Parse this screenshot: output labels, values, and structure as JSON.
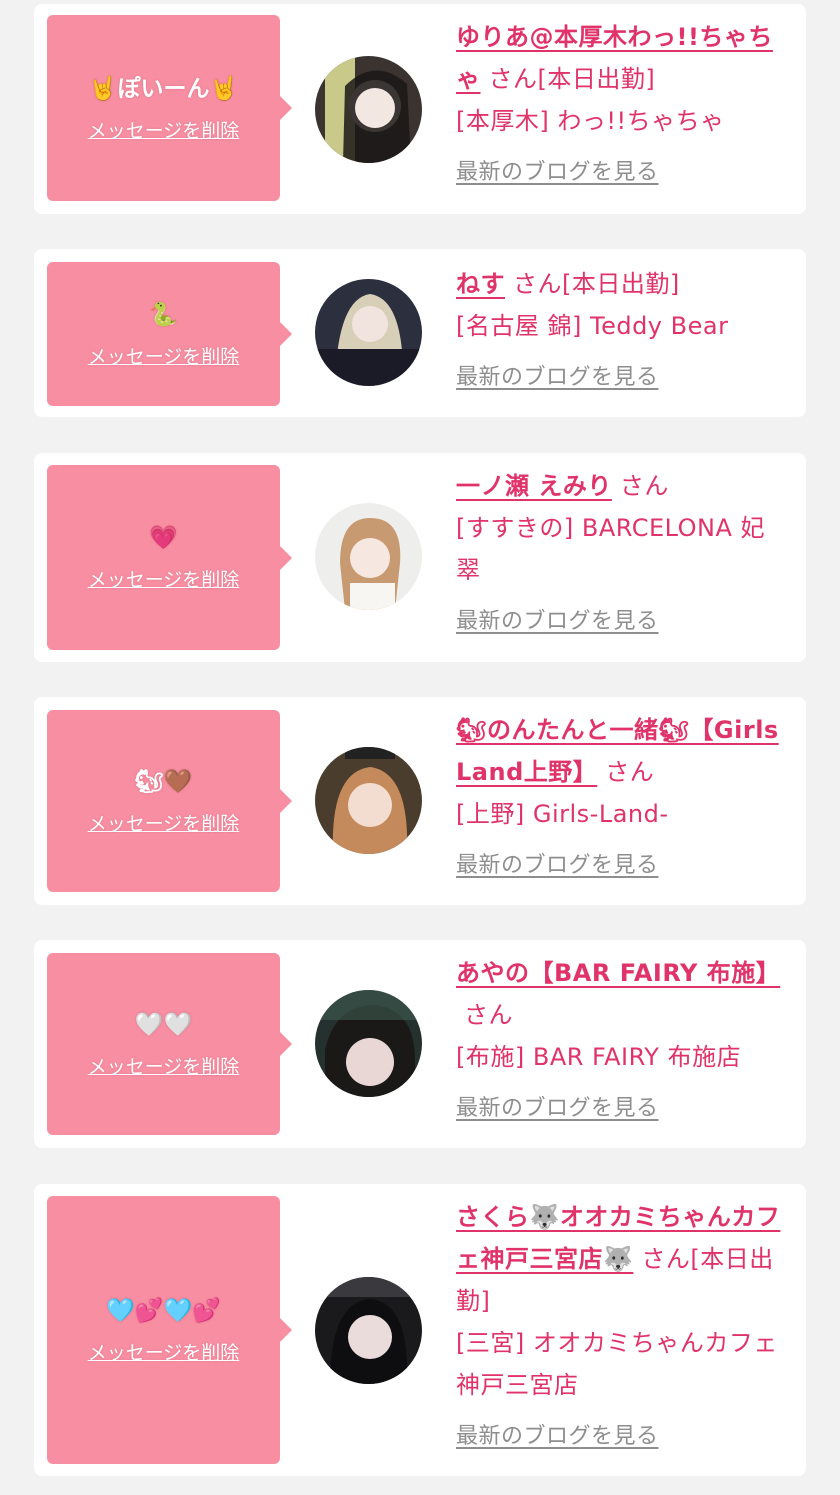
{
  "delete_label": "メッセージを削除",
  "blog_label": "最新のブログを見る",
  "san_suffix": "さん",
  "cards": [
    {
      "message": "🤘ぽいーん🤘",
      "name": "ゆりあ@本厚木わっ!!ちゃちゃ",
      "status": "[本日出勤]",
      "shop": "[本厚木] わっ!!ちゃちゃ"
    },
    {
      "message": "🐍",
      "name": "ねす",
      "status": "[本日出勤]",
      "shop": "[名古屋 錦] Teddy Bear"
    },
    {
      "message": "💗",
      "name": "一ノ瀬 えみり",
      "status": "",
      "shop": "[すすきの] BARCELONA 妃翠"
    },
    {
      "message": "🐿🤎",
      "name": "🐿のんたんと一緒🐿【Girls Land上野】",
      "status": "",
      "shop": "[上野] Girls-Land-"
    },
    {
      "message": "🤍🤍",
      "name": "あやの【BAR FAIRY 布施】",
      "status": "",
      "shop": "[布施] BAR FAIRY 布施店"
    },
    {
      "message": "🩵💕🩵💕",
      "name": "さくら🐺オオカミちゃんカフェ神戸三宮店🐺",
      "status": "[本日出勤]",
      "shop": "[三宮] オオカミちゃんカフェ神戸三宮店"
    }
  ]
}
